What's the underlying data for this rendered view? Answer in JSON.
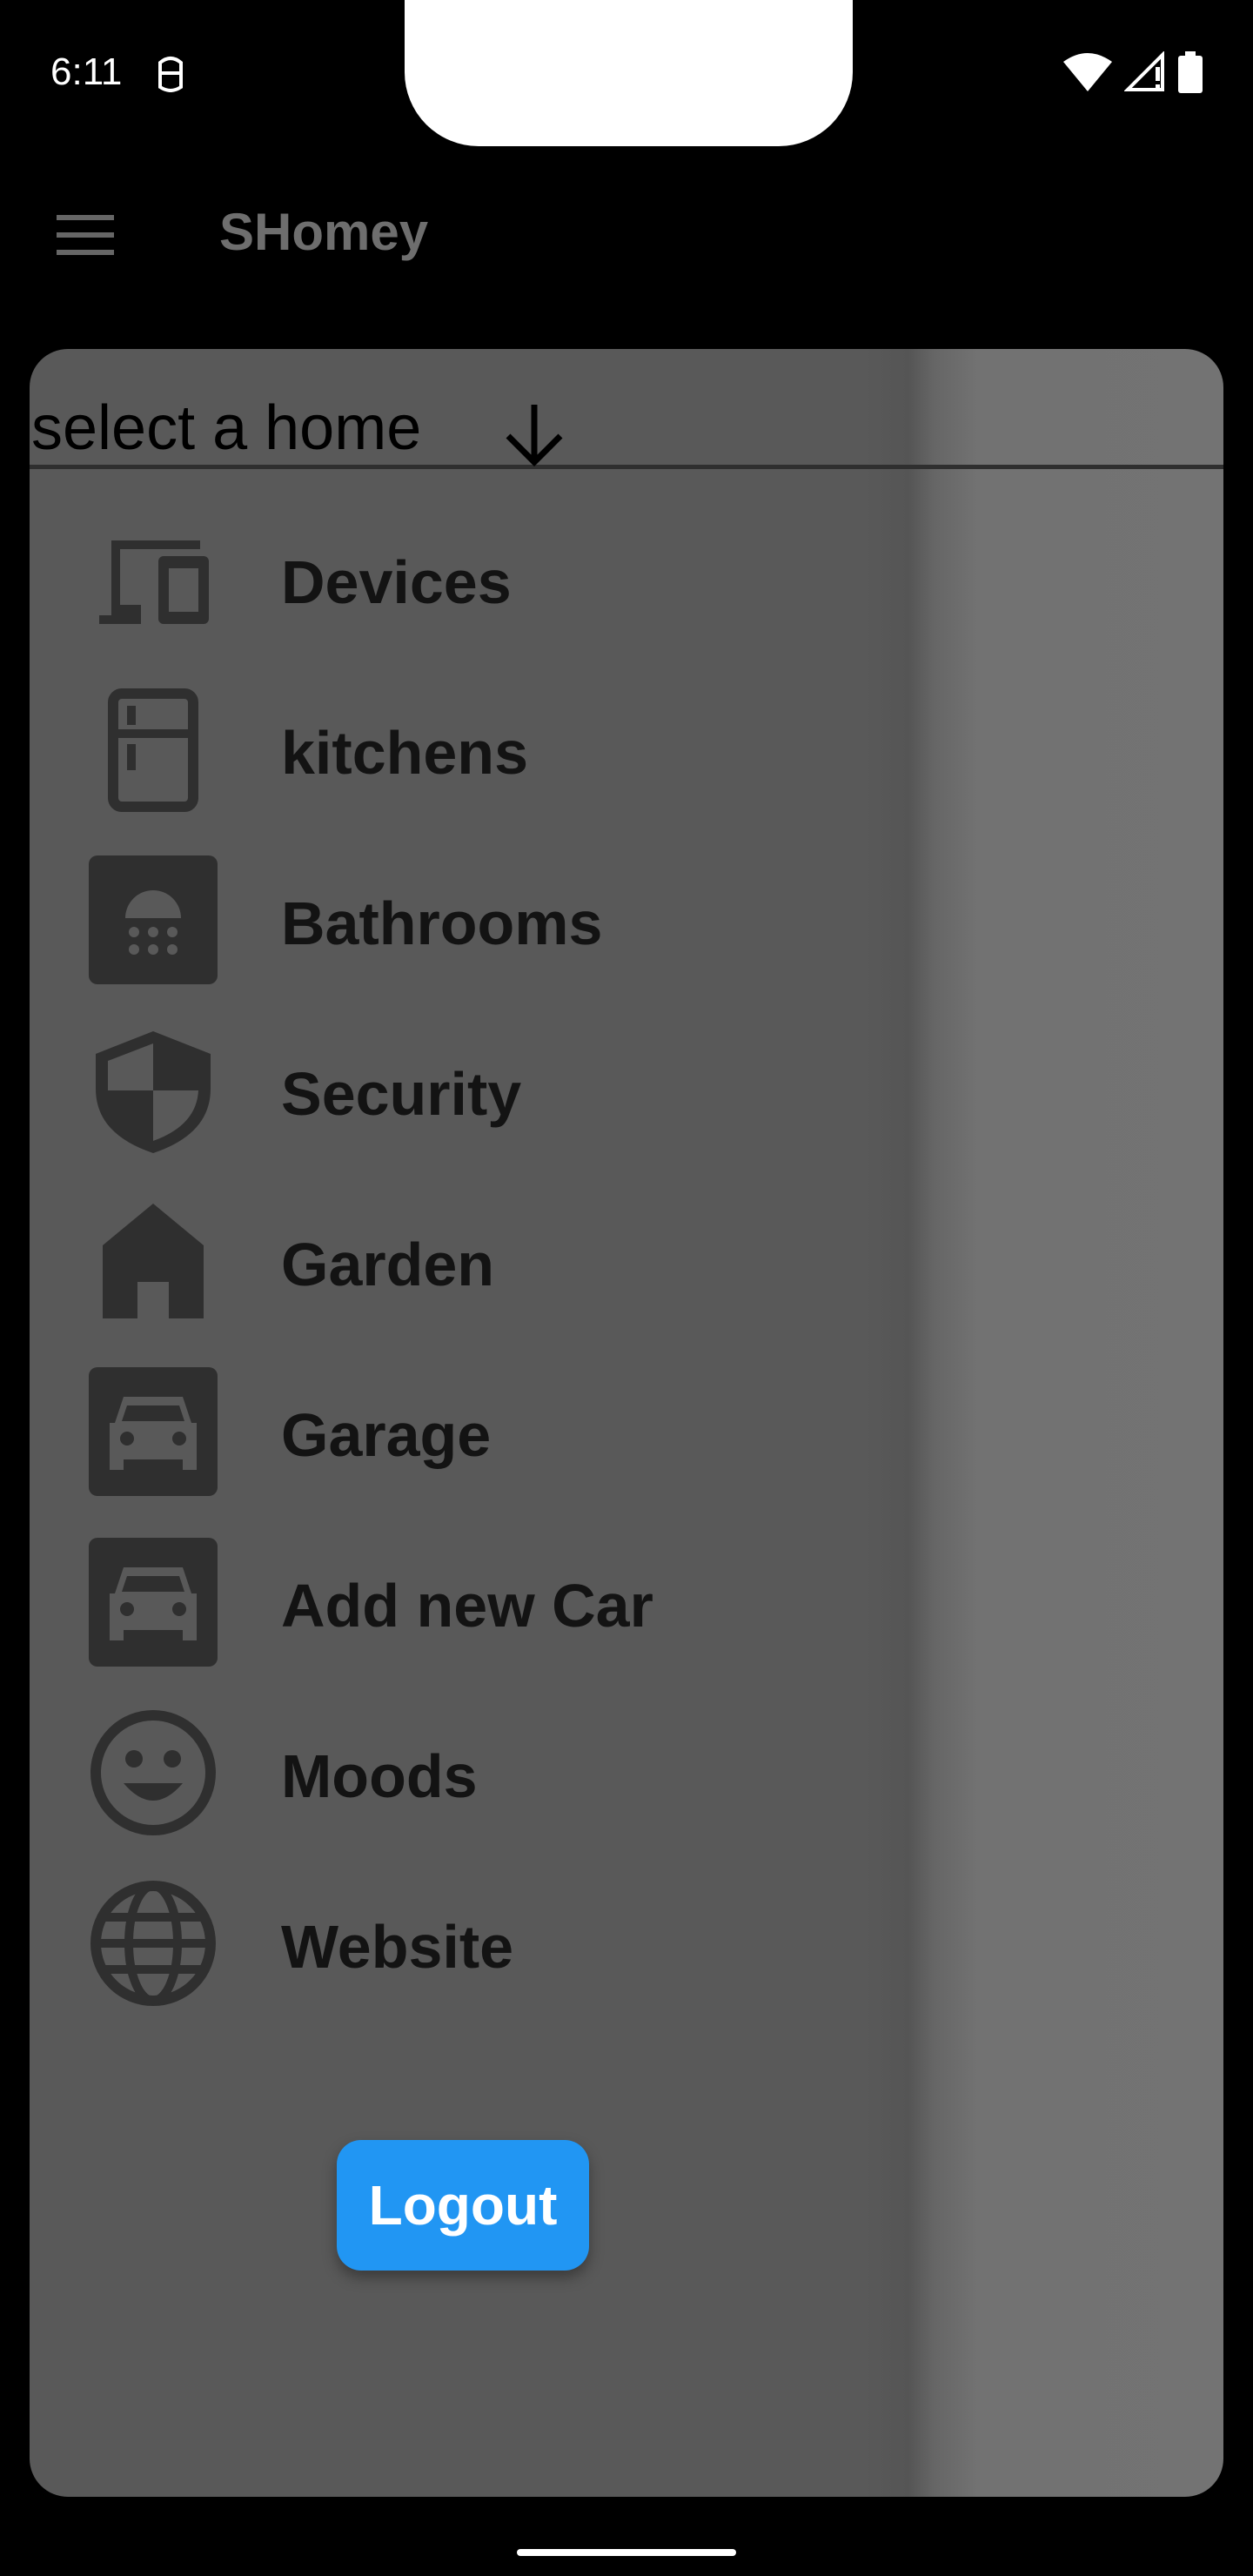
{
  "status_bar": {
    "time": "6:11"
  },
  "app_bar": {
    "title": "SHomey",
    "menu_icon": "hamburger-menu-icon"
  },
  "drawer": {
    "home_select": {
      "label": "select a home",
      "icon": "arrow-down-icon"
    },
    "items": [
      {
        "label": "Devices",
        "icon": "devices-icon"
      },
      {
        "label": "kitchens",
        "icon": "kitchen-icon"
      },
      {
        "label": "Bathrooms",
        "icon": "shower-icon"
      },
      {
        "label": "Security",
        "icon": "security-shield-icon"
      },
      {
        "label": "Garden",
        "icon": "house-icon"
      },
      {
        "label": "Garage",
        "icon": "car-icon"
      },
      {
        "label": "Add new Car",
        "icon": "car-icon"
      },
      {
        "label": "Moods",
        "icon": "mood-icon"
      },
      {
        "label": "Website",
        "icon": "globe-icon"
      }
    ],
    "logout_label": "Logout"
  },
  "colors": {
    "background": "#000000",
    "drawer": "#595959",
    "icon": "#2f2f2f",
    "label_text": "#131313",
    "app_title": "#6e6e6e",
    "logout_button": "#2196f3",
    "logout_text": "#ffffff"
  }
}
